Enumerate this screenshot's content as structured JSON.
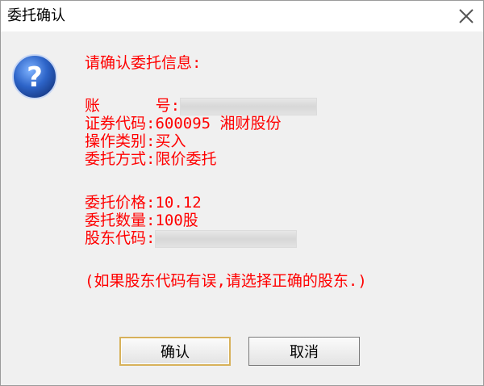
{
  "window": {
    "title": "委托确认"
  },
  "message": {
    "heading": "请确认委托信息:",
    "account_label": "账      号:",
    "code_label": "证券代码:",
    "code_value": "600095 湘财股份",
    "op_label": "操作类别:",
    "op_value": "买入",
    "method_label": "委托方式:",
    "method_value": "限价委托",
    "price_label": "委托价格:",
    "price_value": "10.12",
    "qty_label": "委托数量:",
    "qty_value": "100股",
    "holder_label": "股东代码:",
    "note": "(如果股东代码有误,请选择正确的股东.)"
  },
  "buttons": {
    "confirm": "确认",
    "cancel": "取消"
  },
  "colors": {
    "message_text": "#ff0000",
    "default_button_border": "#d7b15a",
    "icon_blue": "#2d64c8"
  },
  "icons": {
    "close": "close-icon",
    "question": "question-icon"
  }
}
